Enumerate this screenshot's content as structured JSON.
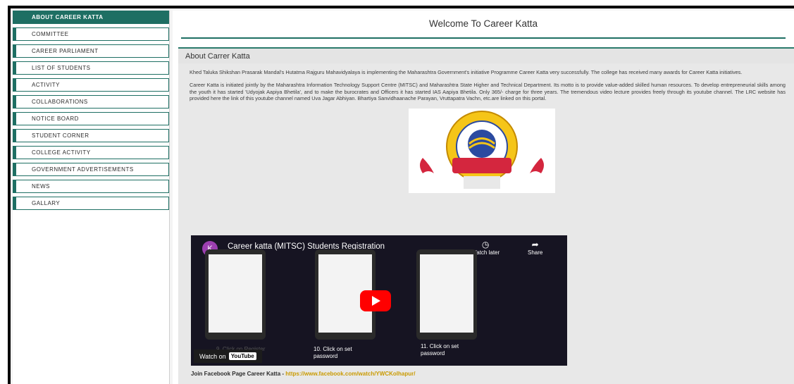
{
  "sidebar": {
    "items": [
      {
        "label": "ABOUT CAREER KATTA"
      },
      {
        "label": "COMMITTEE"
      },
      {
        "label": "CAREER PARLIAMENT"
      },
      {
        "label": "LIST OF STUDENTS"
      },
      {
        "label": "ACTIVITY"
      },
      {
        "label": "COLLABORATIONS"
      },
      {
        "label": "NOTICE BOARD"
      },
      {
        "label": "STUDENT CORNER"
      },
      {
        "label": "COLLEGE ACTIVITY"
      },
      {
        "label": "GOVERNMENT ADVERTISEMENTS"
      },
      {
        "label": "NEWS"
      },
      {
        "label": "GALLARY"
      }
    ]
  },
  "main": {
    "title": "Welcome To Career Katta",
    "section_title": "About Carrer Katta",
    "para1": "Khed Taluka Shikshan Prasarak Mandal's Hutatma Rajguru Mahavidyalaya is implementing the Maharashtra Government's initiative Programme Career Katta very successfully. The college has received many awards for Career Katta initiatives.",
    "para2": "Career Katta is initiated jointly by the Maharashtra Information Technology Support Centre (MITSC) and Maharashtra State Higher and Technical Department. Its motto is to provide value-added skilled human resources. To develop entrepreneurial skills among the youth it has started 'Udyojak Aapiya Bhetila', and to make the burocrates and Officers it has started IAS Aapiya Bhetila.  Only 365/- charge for three years. The tremendous video lecture provides freely through its youtube channel. The LRC website has provided here the link of this youtube channel named Uva Jagar Abhiyan. Bhartiya Sanvidhaanache Parayan, Vruttapatra Vachn, etc.are linked on this portal.",
    "logo_text": "MITSC",
    "logo_ring_text": "Maharashtra Information Technology Support Center",
    "facebook_label": "Join Facebook Page Career Katta - ",
    "facebook_link": "https://www.facebook.com/watch/YWCKolhapur/"
  },
  "video": {
    "channel_initial": "K",
    "title": "Career katta (MITSC) Students Registration",
    "watch_later": "Watch later",
    "share": "Share",
    "caption1": "9. Click on Register",
    "caption2": "10. Click on set password",
    "caption3": "11. Click on set password",
    "watch_on": "Watch on",
    "youtube": "YouTube"
  }
}
